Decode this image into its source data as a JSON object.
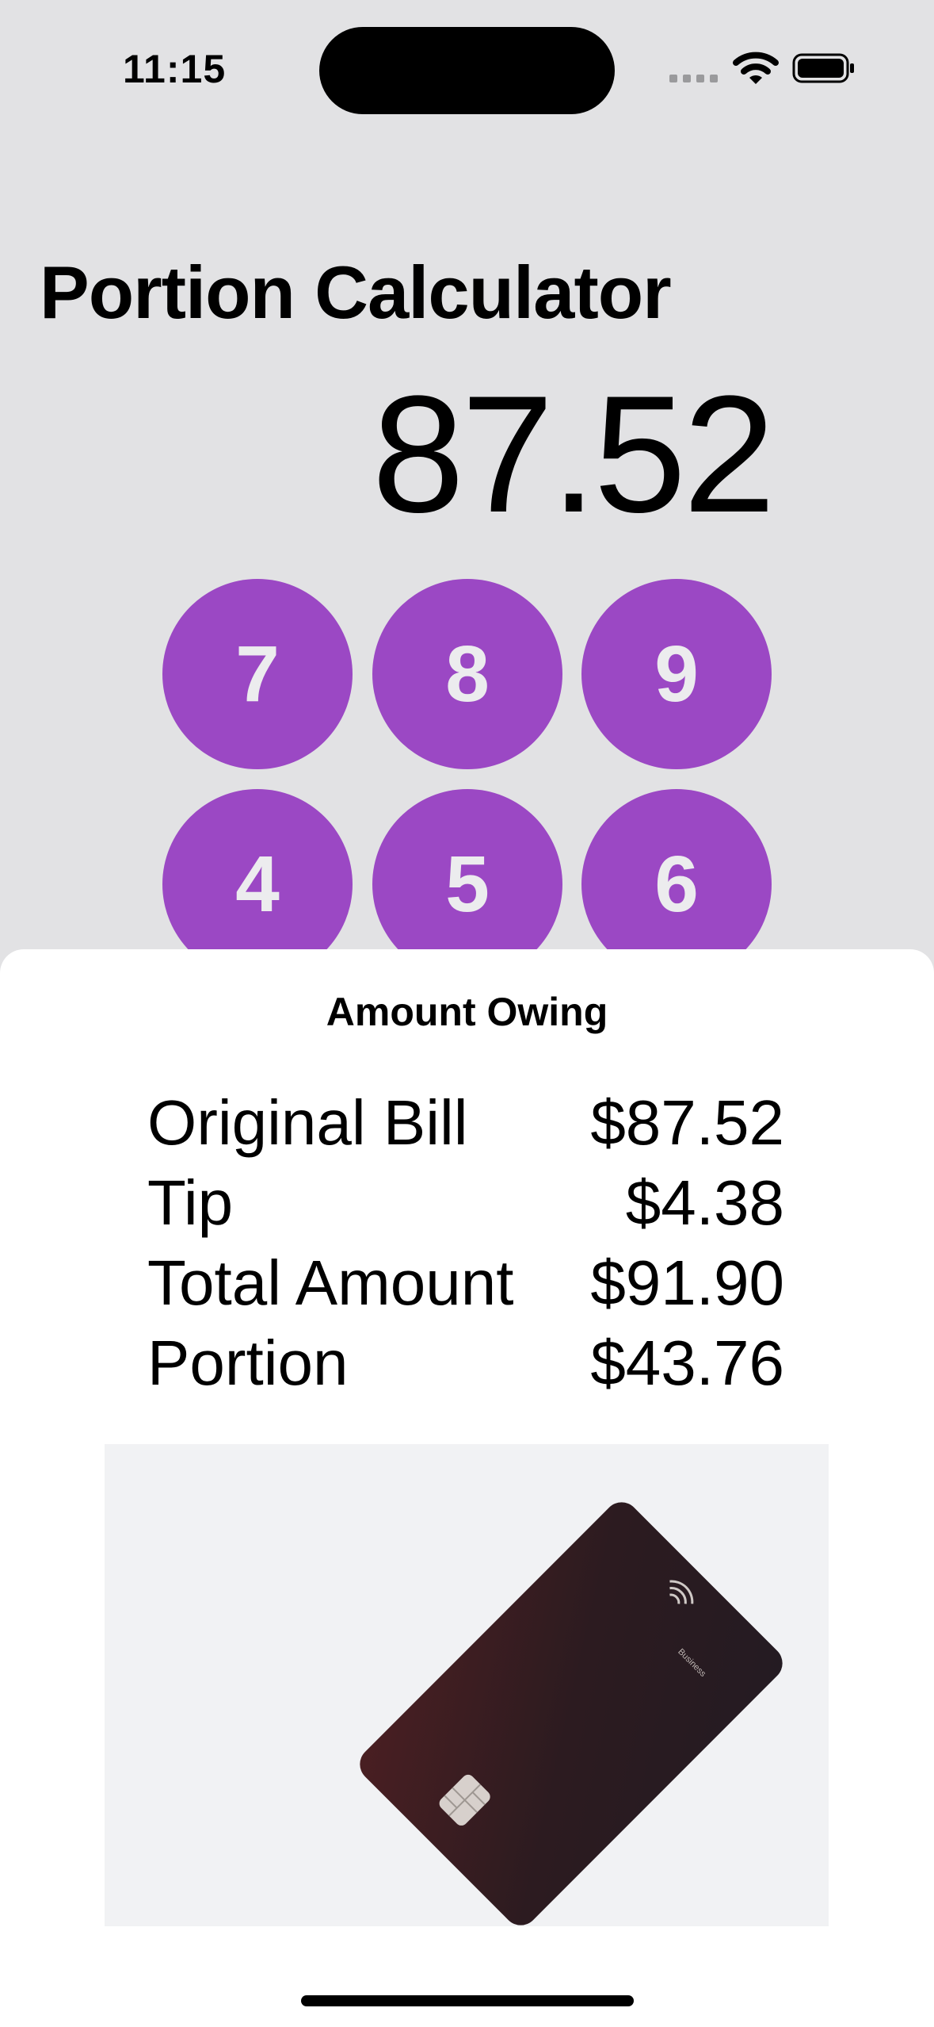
{
  "status_bar": {
    "time": "11:15"
  },
  "header": {
    "title": "Portion Calculator"
  },
  "display": {
    "value": "87.52"
  },
  "keypad": {
    "keys": [
      "7",
      "8",
      "9",
      "4",
      "5",
      "6"
    ],
    "key_color": "#9b48c4"
  },
  "sheet": {
    "title": "Amount Owing",
    "rows": [
      {
        "label": "Original Bill",
        "value": "$87.52"
      },
      {
        "label": "Tip",
        "value": "$4.38"
      },
      {
        "label": "Total Amount",
        "value": "$91.90"
      },
      {
        "label": "Portion",
        "value": "$43.76"
      }
    ],
    "image": {
      "card_text": "Business"
    }
  }
}
